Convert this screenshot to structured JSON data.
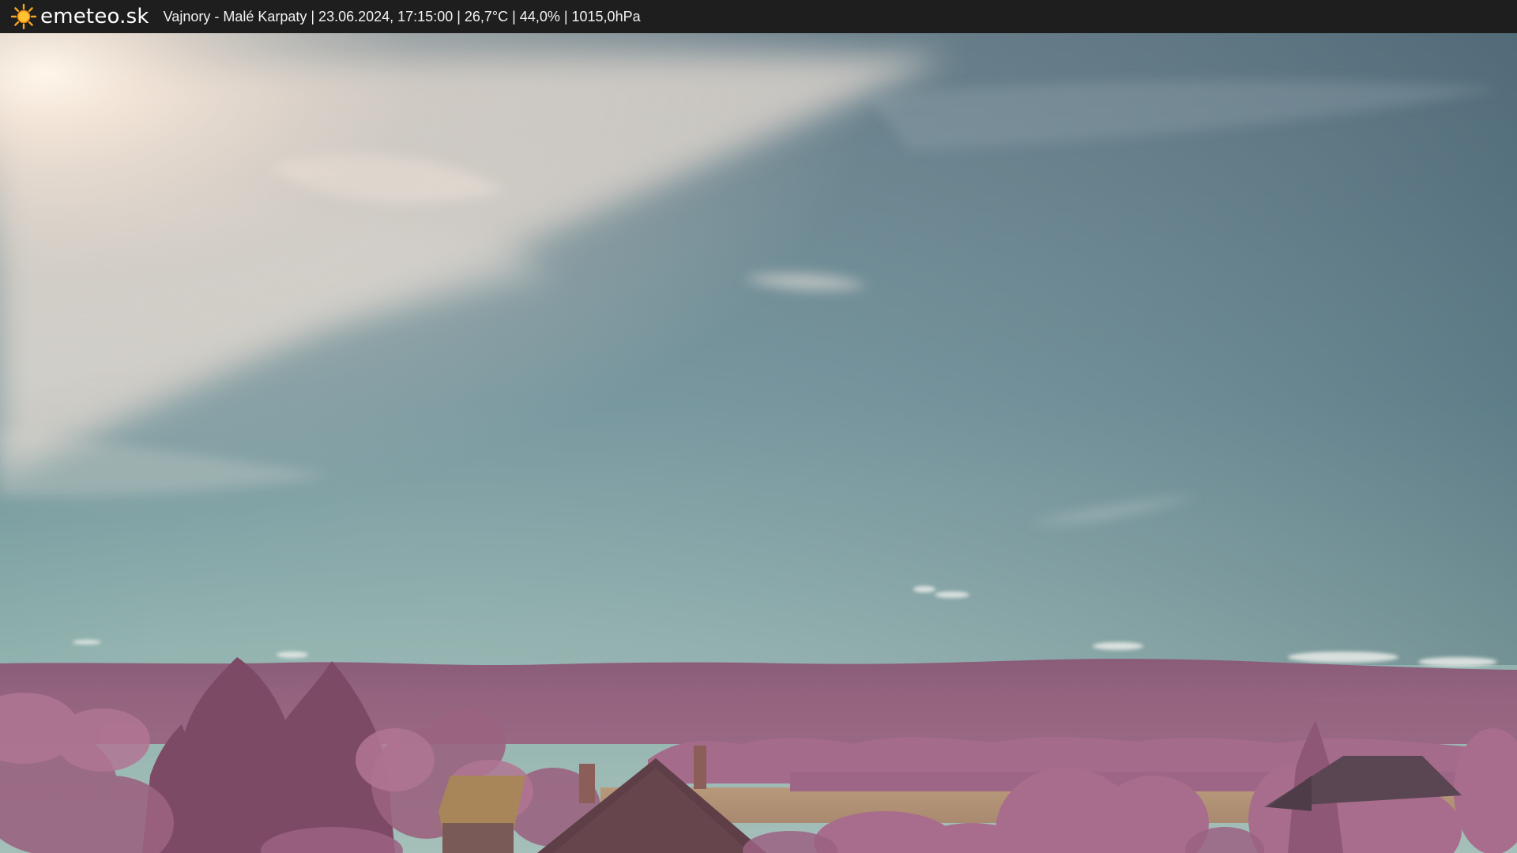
{
  "overlay": {
    "logo": "emeteo.sk",
    "caption": "Vajnory - Malé Karpaty | 23.06.2024, 17:15:00 | 26,7°C | 44,0% | 1015,0hPa",
    "icon": "sun-icon"
  },
  "colors": {
    "bar_background": "#1e1e1e",
    "sky_top": "#55707f",
    "sky_bottom": "#9cbab6",
    "hills": "#8d5f7a",
    "foliage": "#a9708f",
    "field": "#b39476"
  }
}
